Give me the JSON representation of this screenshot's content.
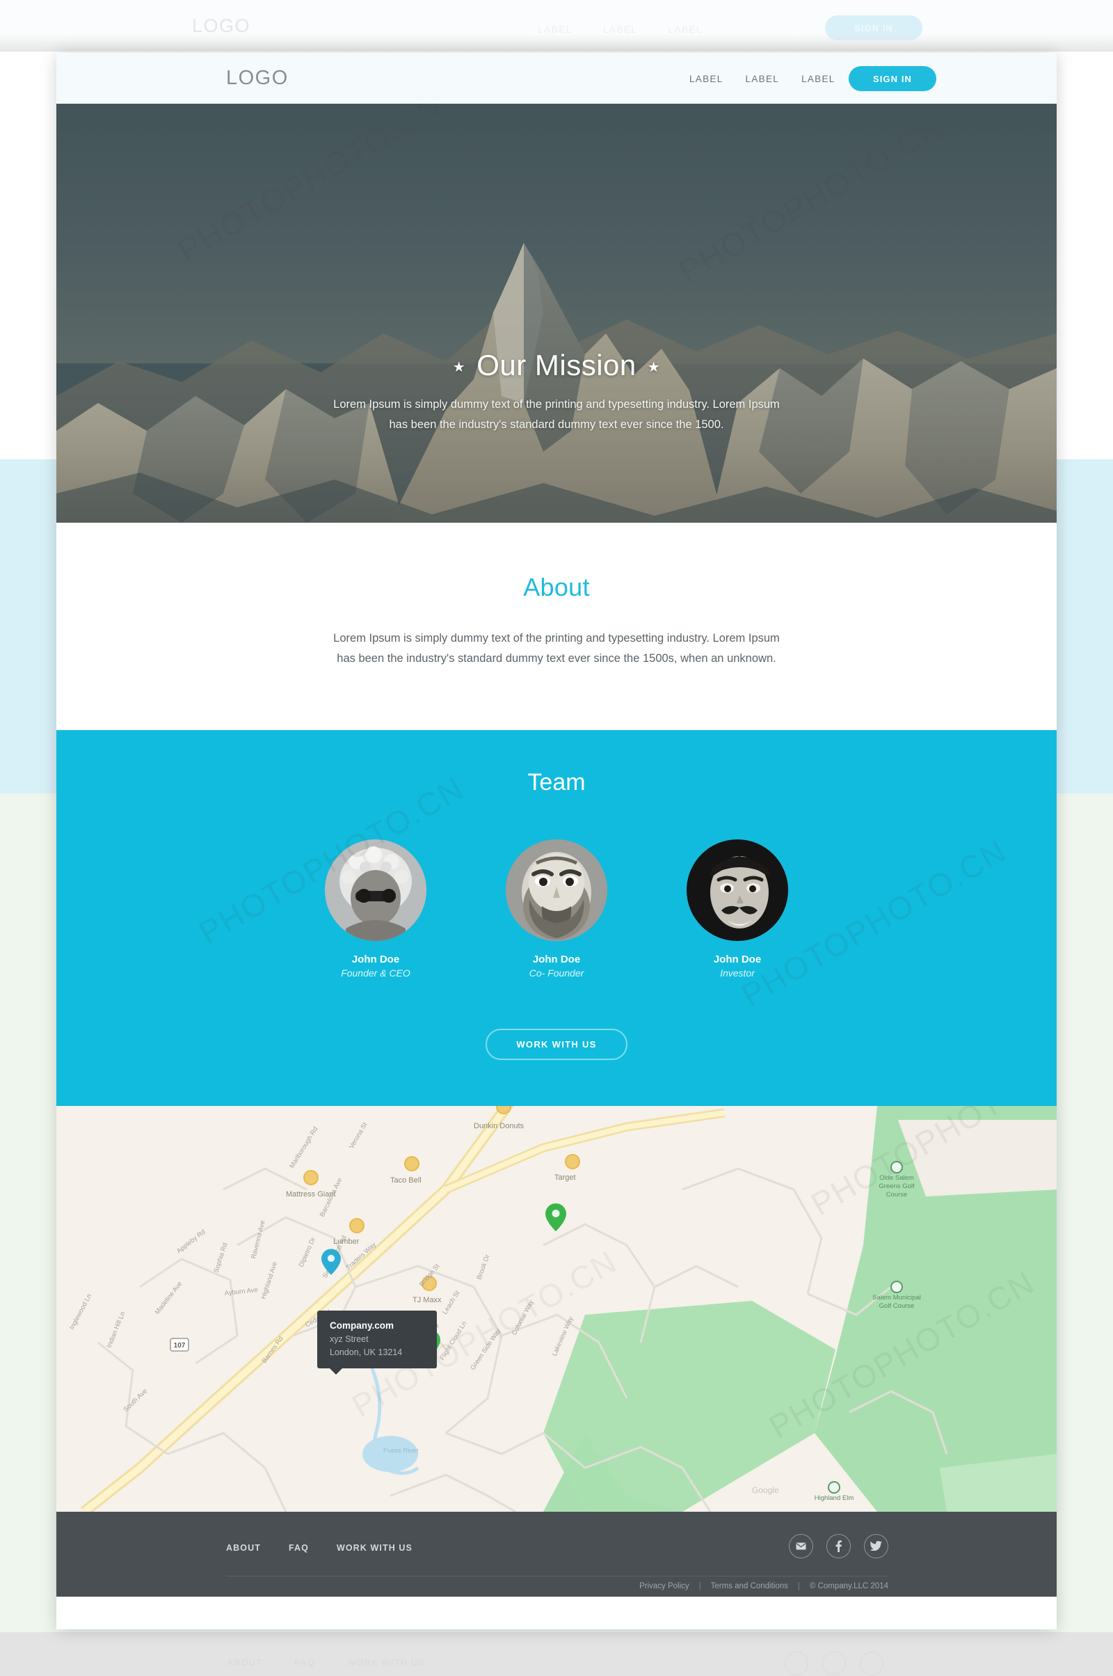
{
  "navbar": {
    "logo": "LOGO",
    "links": [
      "LABEL",
      "LABEL",
      "LABEL"
    ],
    "signin_label": "SIGN IN",
    "accent_color": "#1fbcdd",
    "background_color": "#f5fafc"
  },
  "hero": {
    "title": "Our Mission",
    "star_glyph": "★",
    "subtitle_line1": "Lorem Ipsum is simply dummy text of the printing and typesetting industry. Lorem Ipsum",
    "subtitle_line2": "has been the industry's standard dummy text ever since the 1500.",
    "image_description": "snow-capped mountain range under dark teal sky"
  },
  "about": {
    "title": "About",
    "title_color": "#1fbcdd",
    "text_line1": "Lorem Ipsum is simply dummy text of the printing and typesetting industry. Lorem Ipsum",
    "text_line2": "has been the industry's standard dummy text ever since the 1500s, when an unknown."
  },
  "team": {
    "title": "Team",
    "background_color": "#11bbdd",
    "members": [
      {
        "name": "John Doe",
        "role": "Founder & CEO"
      },
      {
        "name": "John Doe",
        "role": "Co- Founder"
      },
      {
        "name": "John Doe",
        "role": "Investor"
      }
    ],
    "cta_label": "WORK WITH US"
  },
  "map": {
    "tooltip": {
      "title": "Company.com",
      "street": "xyz Street",
      "city": "London, UK 13214"
    },
    "places": [
      "Dunkin Donuts",
      "Taco Bell",
      "Target",
      "TJ Maxx",
      "Mattress Giant",
      "Lumber",
      "Olde Salem Greens Golf Course",
      "Salem Municipal Golf Course",
      "Highland Elm"
    ],
    "streets": [
      "Marlborough Rd",
      "Verona St",
      "Traders Way",
      "Highland Ave",
      "Swampscott Rd",
      "Appleby Rd",
      "Madeline Ave",
      "Sophia Rd",
      "Ravenna Ave",
      "Barcelona Ave",
      "Cedar Rd",
      "Barnes Rd",
      "Ayburn Ave",
      "Inglewood Ln",
      "Indian Hill Ln",
      "Bridge St",
      "Dipietro Dr",
      "Fuess River",
      "South Ave",
      "Leach St"
    ],
    "highway_shield": "107",
    "marker_colors": {
      "primary": "#2dadd4",
      "secondary": "#3bb54a"
    }
  },
  "footer": {
    "background_color": "#4a4f54",
    "links": [
      "ABOUT",
      "FAQ",
      "WORK WITH US"
    ],
    "social": [
      "mail-icon",
      "facebook-icon",
      "twitter-icon"
    ],
    "legal": {
      "privacy": "Privacy Policy",
      "separator": "|",
      "terms": "Terms and Conditions",
      "copyright": "© Company.LLC 2014"
    }
  },
  "watermark": {
    "text": "PHOTOPHOTO.CN"
  }
}
